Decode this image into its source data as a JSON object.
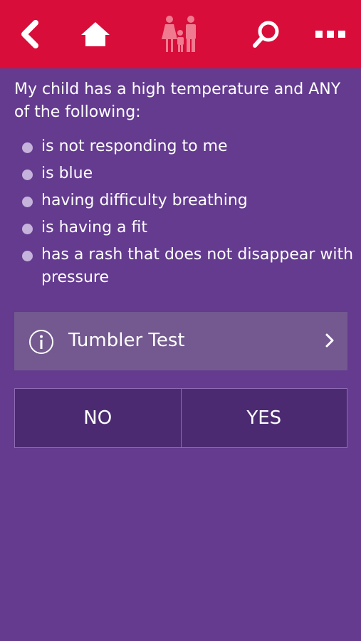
{
  "topbar": {
    "color": "#d80d3a",
    "icons": [
      "back-arrow-icon",
      "home-icon",
      "family-icon",
      "search-icon",
      "more-options-icon"
    ]
  },
  "main": {
    "prompt": "My child has a high temperature and ANY of the following:",
    "symptoms": [
      "is not responding to me",
      "is blue",
      "having difficulty breathing",
      "is having a fit",
      "has a rash that does not disappear with pressure"
    ]
  },
  "tumbler": {
    "label": "Tumbler Test",
    "icon": "info-icon"
  },
  "answers": {
    "no": "NO",
    "yes": "YES"
  },
  "colors": {
    "background": "#643b8f",
    "bullet": "#c5b3dc",
    "tumbler_bg": "#73598f",
    "answer_bg": "#4b2a72"
  }
}
